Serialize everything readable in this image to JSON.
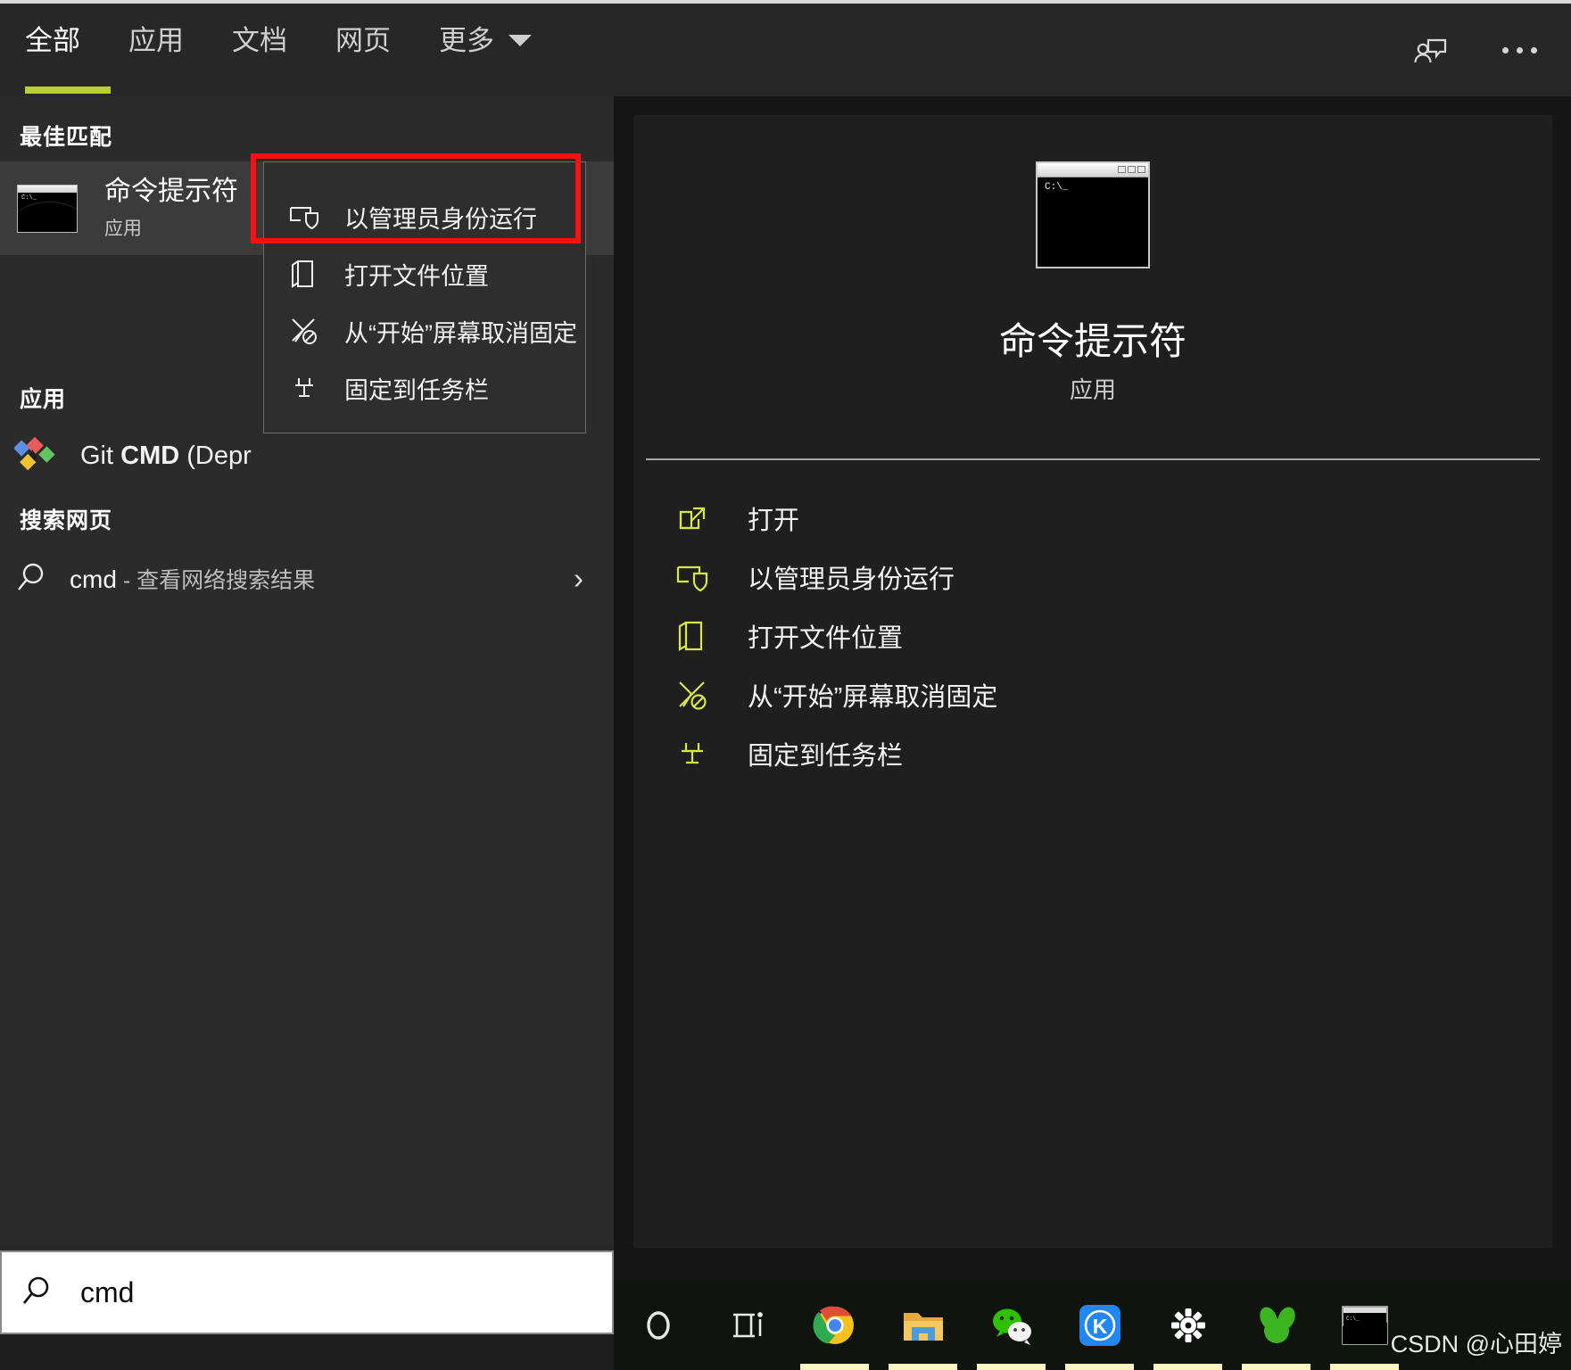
{
  "header": {
    "tabs": [
      {
        "label": "全部",
        "active": true
      },
      {
        "label": "应用",
        "active": false
      },
      {
        "label": "文档",
        "active": false
      },
      {
        "label": "网页",
        "active": false
      },
      {
        "label": "更多",
        "active": false,
        "has_caret": true
      }
    ],
    "icons": [
      {
        "name": "feedback-icon"
      },
      {
        "name": "more-options-icon"
      }
    ],
    "accent_color": "#b9cf2c"
  },
  "left_pane": {
    "best_match": {
      "heading": "最佳匹配",
      "title": "命令提示符",
      "subtitle": "应用",
      "icon_prompt": "C:\\_"
    },
    "apps": {
      "heading": "应用",
      "items": [
        {
          "label_prefix": "Git ",
          "label_bold": "CMD",
          "label_suffix": " (Depr"
        }
      ]
    },
    "web": {
      "heading": "搜索网页",
      "query": "cmd",
      "suffix": " - 查看网络搜索结果"
    }
  },
  "context_menu": {
    "items": [
      {
        "label": "以管理员身份运行",
        "icon": "shield-run-icon",
        "highlighted": true
      },
      {
        "label": "打开文件位置",
        "icon": "folder-open-icon",
        "highlighted": false
      },
      {
        "label": "从“开始”屏幕取消固定",
        "icon": "unpin-start-icon",
        "highlighted": false
      },
      {
        "label": "固定到任务栏",
        "icon": "pin-taskbar-icon",
        "highlighted": false
      }
    ],
    "highlight_color": "#fb0f0f"
  },
  "preview": {
    "title": "命令提示符",
    "subtitle": "应用",
    "icon_prompt": "C:\\_",
    "actions": [
      {
        "label": "打开",
        "icon": "open-external-icon"
      },
      {
        "label": "以管理员身份运行",
        "icon": "shield-run-icon"
      },
      {
        "label": "打开文件位置",
        "icon": "folder-open-icon"
      },
      {
        "label": "从“开始”屏幕取消固定",
        "icon": "unpin-start-icon"
      },
      {
        "label": "固定到任务栏",
        "icon": "pin-taskbar-icon"
      }
    ],
    "action_icon_color": "#d7e64a"
  },
  "search": {
    "value": "cmd",
    "icon": "search-icon"
  },
  "taskbar": {
    "items": [
      {
        "name": "cortana-icon",
        "running": false
      },
      {
        "name": "task-view-icon",
        "running": false
      },
      {
        "name": "chrome-icon",
        "running": true
      },
      {
        "name": "file-explorer-icon",
        "running": true
      },
      {
        "name": "wechat-icon",
        "running": true
      },
      {
        "name": "kingsoft-icon",
        "running": true
      },
      {
        "name": "settings-gear-icon",
        "running": true
      },
      {
        "name": "navicat-icon",
        "running": true
      },
      {
        "name": "command-prompt-icon",
        "running": true
      }
    ]
  },
  "watermark": {
    "text": "CSDN @心田婷"
  }
}
